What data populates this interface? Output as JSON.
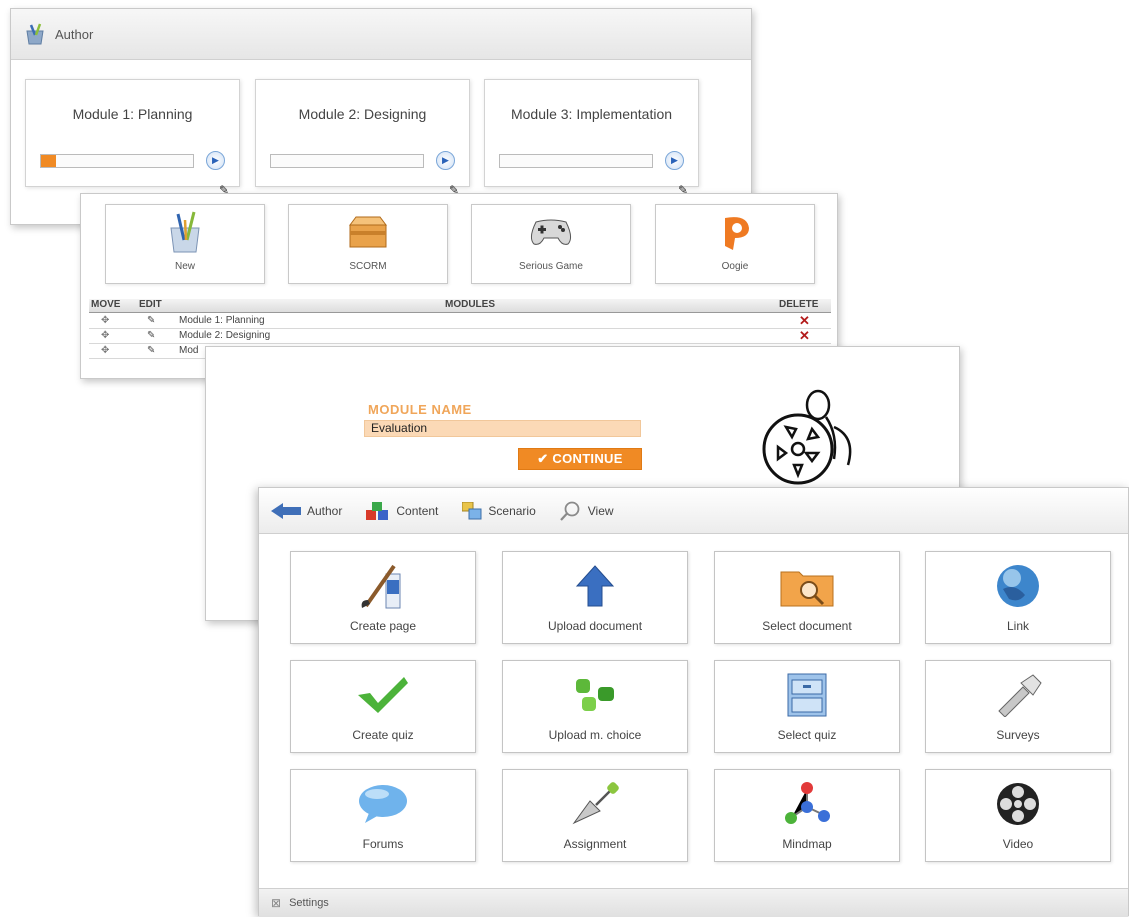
{
  "author_panel": {
    "title": "Author",
    "modules": [
      {
        "name": "Module 1: Planning",
        "progress": 0.1
      },
      {
        "name": "Module 2: Designing",
        "progress": 0
      },
      {
        "name": "Module 3: Implementation",
        "progress": 0
      }
    ]
  },
  "types_panel": {
    "types": [
      {
        "label": "New",
        "icon": "new-module-icon"
      },
      {
        "label": "SCORM",
        "icon": "scorm-box-icon"
      },
      {
        "label": "Serious Game",
        "icon": "gamepad-icon"
      },
      {
        "label": "Oogie",
        "icon": "oogie-logo-icon"
      }
    ],
    "columns": {
      "move": "MOVE",
      "edit": "EDIT",
      "modules": "MODULES",
      "delete": "DELETE"
    },
    "rows": [
      "Module 1: Planning",
      "Module 2: Designing",
      "Mod"
    ]
  },
  "module_name_panel": {
    "label": "MODULE NAME",
    "value": "Evaluation",
    "continue_label": "CONTINUE"
  },
  "content_panel": {
    "toolbar": [
      {
        "label": "Author",
        "icon": "back-arrow-icon"
      },
      {
        "label": "Content",
        "icon": "content-blocks-icon"
      },
      {
        "label": "Scenario",
        "icon": "scenario-icon"
      },
      {
        "label": "View",
        "icon": "magnifier-icon"
      }
    ],
    "tools": [
      {
        "label": "Create page",
        "icon": "paint-brush-icon"
      },
      {
        "label": "Upload document",
        "icon": "upload-arrow-icon"
      },
      {
        "label": "Select document",
        "icon": "folder-search-icon"
      },
      {
        "label": "Link",
        "icon": "globe-icon"
      },
      {
        "label": "Create quiz",
        "icon": "checkmark-icon"
      },
      {
        "label": "Upload m. choice",
        "icon": "upload-choice-icon"
      },
      {
        "label": "Select quiz",
        "icon": "cabinet-icon"
      },
      {
        "label": "Surveys",
        "icon": "flashlight-icon"
      },
      {
        "label": "Forums",
        "icon": "speech-bubble-icon"
      },
      {
        "label": "Assignment",
        "icon": "trowel-icon"
      },
      {
        "label": "Mindmap",
        "icon": "mindmap-icon"
      },
      {
        "label": "Video",
        "icon": "film-reel-icon"
      }
    ],
    "footer_label": "Settings"
  },
  "colors": {
    "accent": "#f08a24",
    "input_bg": "#fbd9b6",
    "label": "#f0a65a",
    "delete": "#b31b1b"
  }
}
